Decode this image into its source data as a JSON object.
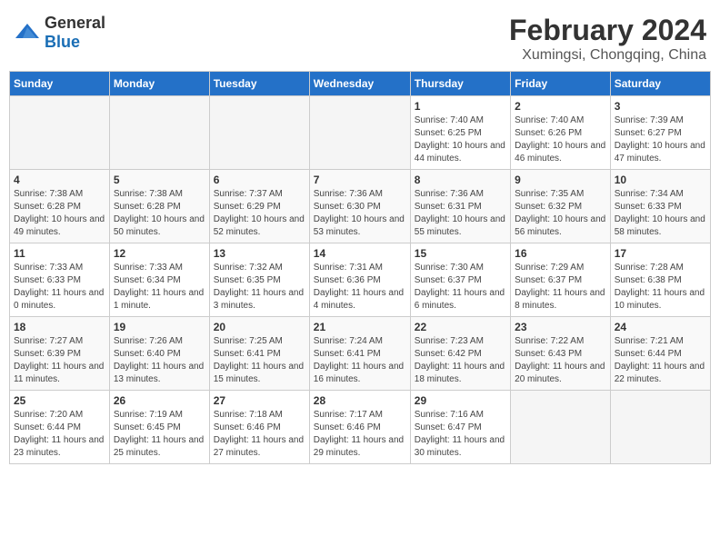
{
  "header": {
    "logo_general": "General",
    "logo_blue": "Blue",
    "title": "February 2024",
    "subtitle": "Xumingsi, Chongqing, China"
  },
  "calendar": {
    "days_of_week": [
      "Sunday",
      "Monday",
      "Tuesday",
      "Wednesday",
      "Thursday",
      "Friday",
      "Saturday"
    ],
    "weeks": [
      [
        {
          "day": "",
          "empty": true
        },
        {
          "day": "",
          "empty": true
        },
        {
          "day": "",
          "empty": true
        },
        {
          "day": "",
          "empty": true
        },
        {
          "day": "1",
          "sunrise": "7:40 AM",
          "sunset": "6:25 PM",
          "daylight": "10 hours and 44 minutes."
        },
        {
          "day": "2",
          "sunrise": "7:40 AM",
          "sunset": "6:26 PM",
          "daylight": "10 hours and 46 minutes."
        },
        {
          "day": "3",
          "sunrise": "7:39 AM",
          "sunset": "6:27 PM",
          "daylight": "10 hours and 47 minutes."
        }
      ],
      [
        {
          "day": "4",
          "sunrise": "7:38 AM",
          "sunset": "6:28 PM",
          "daylight": "10 hours and 49 minutes."
        },
        {
          "day": "5",
          "sunrise": "7:38 AM",
          "sunset": "6:28 PM",
          "daylight": "10 hours and 50 minutes."
        },
        {
          "day": "6",
          "sunrise": "7:37 AM",
          "sunset": "6:29 PM",
          "daylight": "10 hours and 52 minutes."
        },
        {
          "day": "7",
          "sunrise": "7:36 AM",
          "sunset": "6:30 PM",
          "daylight": "10 hours and 53 minutes."
        },
        {
          "day": "8",
          "sunrise": "7:36 AM",
          "sunset": "6:31 PM",
          "daylight": "10 hours and 55 minutes."
        },
        {
          "day": "9",
          "sunrise": "7:35 AM",
          "sunset": "6:32 PM",
          "daylight": "10 hours and 56 minutes."
        },
        {
          "day": "10",
          "sunrise": "7:34 AM",
          "sunset": "6:33 PM",
          "daylight": "10 hours and 58 minutes."
        }
      ],
      [
        {
          "day": "11",
          "sunrise": "7:33 AM",
          "sunset": "6:33 PM",
          "daylight": "11 hours and 0 minutes."
        },
        {
          "day": "12",
          "sunrise": "7:33 AM",
          "sunset": "6:34 PM",
          "daylight": "11 hours and 1 minute."
        },
        {
          "day": "13",
          "sunrise": "7:32 AM",
          "sunset": "6:35 PM",
          "daylight": "11 hours and 3 minutes."
        },
        {
          "day": "14",
          "sunrise": "7:31 AM",
          "sunset": "6:36 PM",
          "daylight": "11 hours and 4 minutes."
        },
        {
          "day": "15",
          "sunrise": "7:30 AM",
          "sunset": "6:37 PM",
          "daylight": "11 hours and 6 minutes."
        },
        {
          "day": "16",
          "sunrise": "7:29 AM",
          "sunset": "6:37 PM",
          "daylight": "11 hours and 8 minutes."
        },
        {
          "day": "17",
          "sunrise": "7:28 AM",
          "sunset": "6:38 PM",
          "daylight": "11 hours and 10 minutes."
        }
      ],
      [
        {
          "day": "18",
          "sunrise": "7:27 AM",
          "sunset": "6:39 PM",
          "daylight": "11 hours and 11 minutes."
        },
        {
          "day": "19",
          "sunrise": "7:26 AM",
          "sunset": "6:40 PM",
          "daylight": "11 hours and 13 minutes."
        },
        {
          "day": "20",
          "sunrise": "7:25 AM",
          "sunset": "6:41 PM",
          "daylight": "11 hours and 15 minutes."
        },
        {
          "day": "21",
          "sunrise": "7:24 AM",
          "sunset": "6:41 PM",
          "daylight": "11 hours and 16 minutes."
        },
        {
          "day": "22",
          "sunrise": "7:23 AM",
          "sunset": "6:42 PM",
          "daylight": "11 hours and 18 minutes."
        },
        {
          "day": "23",
          "sunrise": "7:22 AM",
          "sunset": "6:43 PM",
          "daylight": "11 hours and 20 minutes."
        },
        {
          "day": "24",
          "sunrise": "7:21 AM",
          "sunset": "6:44 PM",
          "daylight": "11 hours and 22 minutes."
        }
      ],
      [
        {
          "day": "25",
          "sunrise": "7:20 AM",
          "sunset": "6:44 PM",
          "daylight": "11 hours and 23 minutes."
        },
        {
          "day": "26",
          "sunrise": "7:19 AM",
          "sunset": "6:45 PM",
          "daylight": "11 hours and 25 minutes."
        },
        {
          "day": "27",
          "sunrise": "7:18 AM",
          "sunset": "6:46 PM",
          "daylight": "11 hours and 27 minutes."
        },
        {
          "day": "28",
          "sunrise": "7:17 AM",
          "sunset": "6:46 PM",
          "daylight": "11 hours and 29 minutes."
        },
        {
          "day": "29",
          "sunrise": "7:16 AM",
          "sunset": "6:47 PM",
          "daylight": "11 hours and 30 minutes."
        },
        {
          "day": "",
          "empty": true
        },
        {
          "day": "",
          "empty": true
        }
      ]
    ]
  }
}
